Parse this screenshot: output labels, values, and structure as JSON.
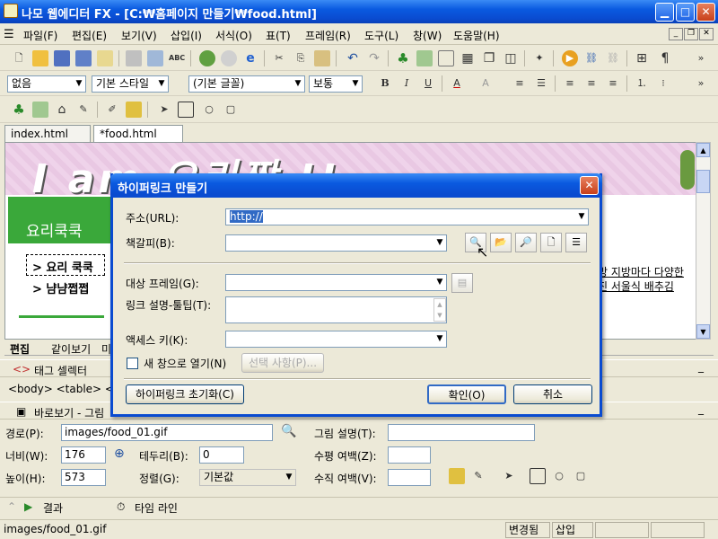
{
  "window": {
    "title": "나모 웹에디터 FX - [C:₩홈페이지 만들기₩food.html]"
  },
  "menu": [
    "파일(F)",
    "편집(E)",
    "보기(V)",
    "삽입(I)",
    "서식(O)",
    "표(T)",
    "프레임(R)",
    "도구(L)",
    "창(W)",
    "도움말(H)"
  ],
  "format_bar": {
    "paragraph": "없음",
    "style": "기본 스타일",
    "font": "(기본 글꼴)",
    "size": "보통"
  },
  "doc_tabs": [
    "index.html",
    "*food.html"
  ],
  "page": {
    "banner_text": "I am 요리짱 !!",
    "side_title": "요리쿡쿡",
    "nav_links": [
      "> 요리 쿡쿡",
      "> 냠냠쩝쩝"
    ],
    "right_text": [
      "방 지방마다 다양한",
      "진 서울식 배추김"
    ]
  },
  "view_tabs": [
    "편집",
    "같이보기",
    "미"
  ],
  "tag_selector": {
    "title": "태그 셀렉터",
    "path": "<body> <table> <tr>"
  },
  "props_panel": {
    "title": "바로보기 - 그림",
    "path_label": "경로(P):",
    "path_value": "images/food_01.gif",
    "width_label": "너비(W):",
    "width_value": "176",
    "height_label": "높이(H):",
    "height_value": "573",
    "border_label": "테두리(B):",
    "border_value": "0",
    "align_label": "정렬(G):",
    "align_value": "기본값",
    "desc_label": "그림 설명(T):",
    "hspace_label": "수평 여백(Z):",
    "vspace_label": "수직 여백(V):"
  },
  "bottom_tabs": [
    "결과",
    "타임 라인"
  ],
  "status": {
    "path": "images/food_01.gif",
    "modified": "변경됨",
    "mode": "삽입"
  },
  "dialog": {
    "title": "하이퍼링크 만들기",
    "url_label": "주소(URL):",
    "url_value": "http://",
    "bookmark_label": "책갈피(B):",
    "target_label": "대상 프레임(G):",
    "tooltip_label": "링크 설명-툴팁(T):",
    "access_label": "액세스 키(K):",
    "newwin_label": "새 창으로 열기(N)",
    "options_button": "선택 사항(P)...",
    "reset_button": "하이퍼링크 초기화(C)",
    "ok_button": "확인(O)",
    "cancel_button": "취소"
  },
  "icons": {
    "toolbar1": [
      "new-icon",
      "open-icon",
      "save-icon",
      "save-all-icon",
      "template-icon",
      "print-icon",
      "preview-icon",
      "spellcheck-icon",
      "browser-icon",
      "stop-icon",
      "ie-icon",
      "cut-icon",
      "copy-icon",
      "paste-icon",
      "undo-icon",
      "redo-icon",
      "tree-icon",
      "image-icon",
      "form-icon",
      "table-icon",
      "layer-icon",
      "frame-icon",
      "wand-icon",
      "media-icon",
      "link-icon",
      "unlink-icon",
      "grid-icon",
      "pilcrow-icon"
    ],
    "colors": {
      "titlebar": "#0a5ae0",
      "accent_green": "#3aa83a",
      "banner_pink": "#efd3ea"
    }
  }
}
